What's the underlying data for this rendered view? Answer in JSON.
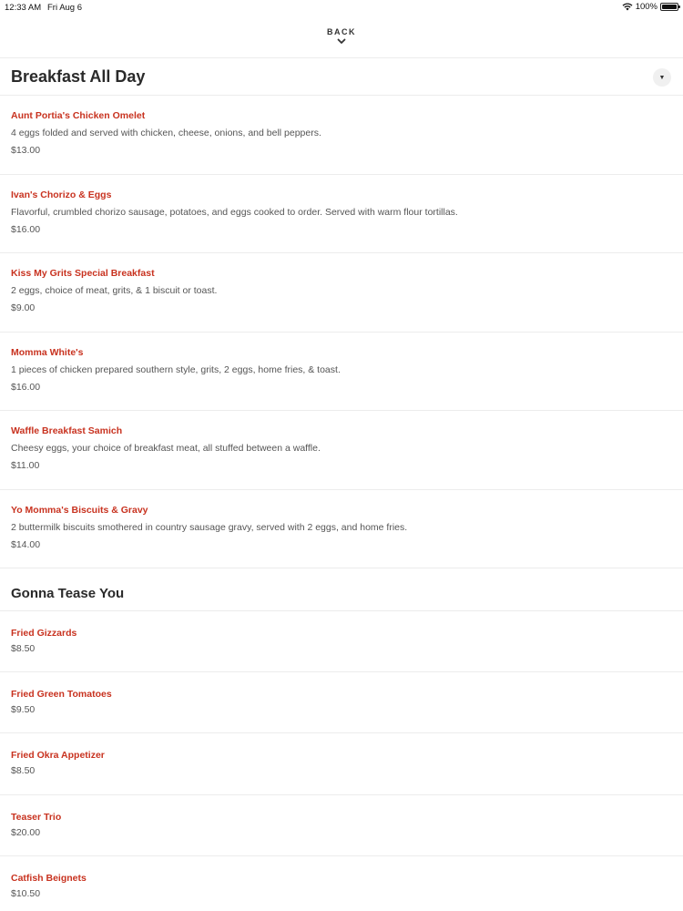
{
  "status_bar": {
    "time": "12:33 AM",
    "date": "Fri Aug 6",
    "battery": "100%"
  },
  "nav": {
    "back_label": "BACK"
  },
  "sections": [
    {
      "title": "Breakfast All Day",
      "items": [
        {
          "name": "Aunt Portia's Chicken Omelet",
          "description": "4 eggs folded and served with chicken, cheese, onions, and bell peppers.",
          "price": "$13.00"
        },
        {
          "name": "Ivan's Chorizo & Eggs",
          "description": "Flavorful, crumbled chorizo sausage, potatoes, and eggs cooked to order. Served with warm flour tortillas.",
          "price": "$16.00"
        },
        {
          "name": "Kiss My Grits Special Breakfast",
          "description": "2 eggs, choice of meat, grits, & 1 biscuit or toast.",
          "price": "$9.00"
        },
        {
          "name": "Momma White's",
          "description": "1 pieces of chicken prepared southern style, grits, 2 eggs, home fries, & toast.",
          "price": "$16.00"
        },
        {
          "name": "Waffle Breakfast Samich",
          "description": "Cheesy eggs, your choice of breakfast meat, all stuffed between a waffle.",
          "price": "$11.00"
        },
        {
          "name": "Yo Momma's Biscuits & Gravy",
          "description": "2 buttermilk biscuits smothered in country sausage gravy, served with 2 eggs, and home fries.",
          "price": "$14.00"
        }
      ]
    },
    {
      "title": "Gonna Tease You",
      "items": [
        {
          "name": "Fried Gizzards",
          "price": "$8.50"
        },
        {
          "name": "Fried Green Tomatoes",
          "price": "$9.50"
        },
        {
          "name": "Fried Okra Appetizer",
          "price": "$8.50"
        },
        {
          "name": "Teaser Trio",
          "price": "$20.00"
        },
        {
          "name": "Catfish Beignets",
          "price": "$10.50"
        }
      ]
    }
  ],
  "colors": {
    "item_name": "#c8321f",
    "divider": "#ececec"
  }
}
